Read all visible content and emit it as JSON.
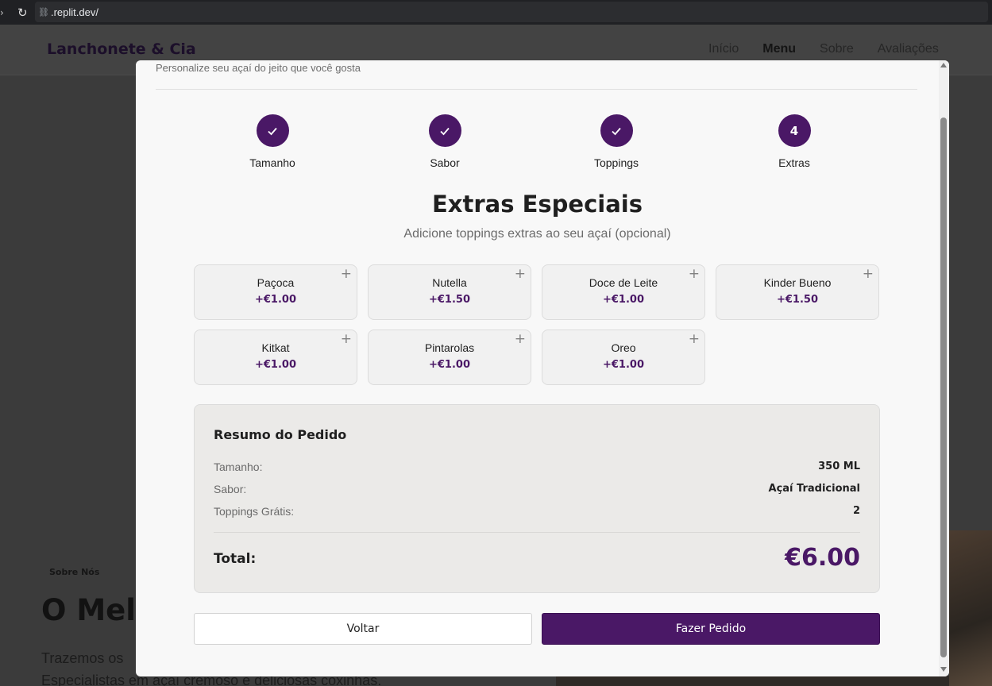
{
  "browser": {
    "url": ".replit.dev/"
  },
  "site": {
    "brand": "Lanchonete & Cia",
    "nav": [
      {
        "label": "Início",
        "active": false
      },
      {
        "label": "Menu",
        "active": true
      },
      {
        "label": "Sobre",
        "active": false
      },
      {
        "label": "Avaliações",
        "active": false
      }
    ],
    "about_tag": "Sobre Nós",
    "about_heading": "O Melh",
    "about_text_1": "Trazemos os",
    "about_text_2": "Especialistas em açaí cremoso e deliciosas coxinhas."
  },
  "modal": {
    "subtitle": "Personalize seu açaí do jeito que você gosta",
    "steps": [
      {
        "label": "Tamanho",
        "state": "done"
      },
      {
        "label": "Sabor",
        "state": "done"
      },
      {
        "label": "Toppings",
        "state": "done"
      },
      {
        "label": "Extras",
        "state": "current",
        "number": "4"
      }
    ],
    "title": "Extras Especiais",
    "description": "Adicione toppings extras ao seu açaí (opcional)",
    "extras": [
      {
        "name": "Paçoca",
        "price": "+€1.00"
      },
      {
        "name": "Nutella",
        "price": "+€1.50"
      },
      {
        "name": "Doce de Leite",
        "price": "+€1.00"
      },
      {
        "name": "Kinder Bueno",
        "price": "+€1.50"
      },
      {
        "name": "Kitkat",
        "price": "+€1.00"
      },
      {
        "name": "Pintarolas",
        "price": "+€1.00"
      },
      {
        "name": "Oreo",
        "price": "+€1.00"
      }
    ],
    "summary": {
      "title": "Resumo do Pedido",
      "rows": [
        {
          "label": "Tamanho:",
          "value": "350 ML"
        },
        {
          "label": "Sabor:",
          "value": "Açaí Tradicional"
        },
        {
          "label": "Toppings Grátis:",
          "value": "2"
        }
      ],
      "total_label": "Total:",
      "total_value": "€6.00"
    },
    "buttons": {
      "back": "Voltar",
      "order": "Fazer Pedido"
    }
  },
  "colors": {
    "accent": "#4a1866",
    "overlay": "#3b3b3b"
  }
}
